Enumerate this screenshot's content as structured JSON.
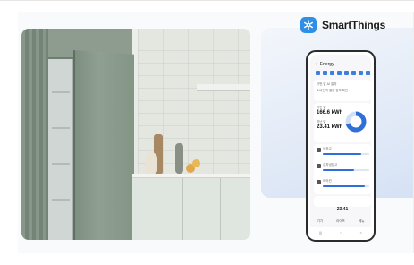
{
  "brand": {
    "name": "SmartThings",
    "icon": "smartthings-snowflake-icon",
    "color": "#2f8fe6"
  },
  "phone": {
    "screen_title": "Energy",
    "summary_label": "이번 달 AI 절약",
    "summary_note": "소비전력 절감 정보 확인",
    "stat1_label": "이번 달",
    "stat1_value": "166.6 kWh",
    "stat2_label": "지난 달",
    "stat2_value": "23.41 kWh",
    "rows": [
      {
        "label": "냉장고",
        "fill": 0.82
      },
      {
        "label": "김치냉장고",
        "fill": 0.68
      },
      {
        "label": "에어컨",
        "fill": 0.9
      }
    ],
    "footer_value": "23.41",
    "tabs": [
      "기기",
      "라이프",
      "메뉴"
    ],
    "nav": [
      "|||",
      "○",
      "<"
    ]
  },
  "colors": {
    "accent": "#2e6fd8",
    "panel": "#dfe8f6",
    "cabinet": "#8d9c8f"
  }
}
